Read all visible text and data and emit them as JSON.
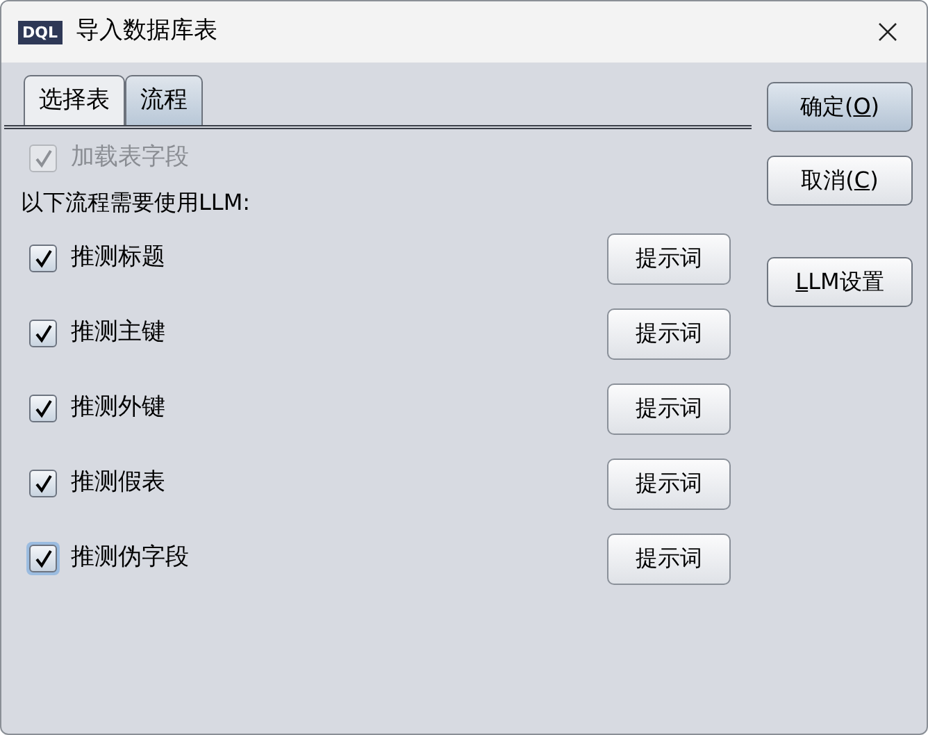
{
  "window": {
    "logo": "DQL",
    "title": "导入数据库表"
  },
  "tabs": [
    {
      "label": "选择表",
      "selected": false
    },
    {
      "label": "流程",
      "selected": true
    }
  ],
  "load_fields": {
    "label": "加载表字段",
    "checked": true,
    "disabled": true
  },
  "intro": "以下流程需要使用LLM:",
  "steps": [
    {
      "label": "推测标题",
      "checked": true,
      "focused": false,
      "button": "提示词"
    },
    {
      "label": "推测主键",
      "checked": true,
      "focused": false,
      "button": "提示词"
    },
    {
      "label": "推测外键",
      "checked": true,
      "focused": false,
      "button": "提示词"
    },
    {
      "label": "推测假表",
      "checked": true,
      "focused": false,
      "button": "提示词"
    },
    {
      "label": "推测伪字段",
      "checked": true,
      "focused": true,
      "button": "提示词"
    }
  ],
  "buttons": [
    {
      "before": "确定(",
      "mnemonic": "O",
      "after": ")",
      "default": true
    },
    {
      "before": "取消(",
      "mnemonic": "C",
      "after": ")",
      "default": false
    },
    {
      "mnemonic": "L",
      "after": "LM设置",
      "default": false
    }
  ]
}
